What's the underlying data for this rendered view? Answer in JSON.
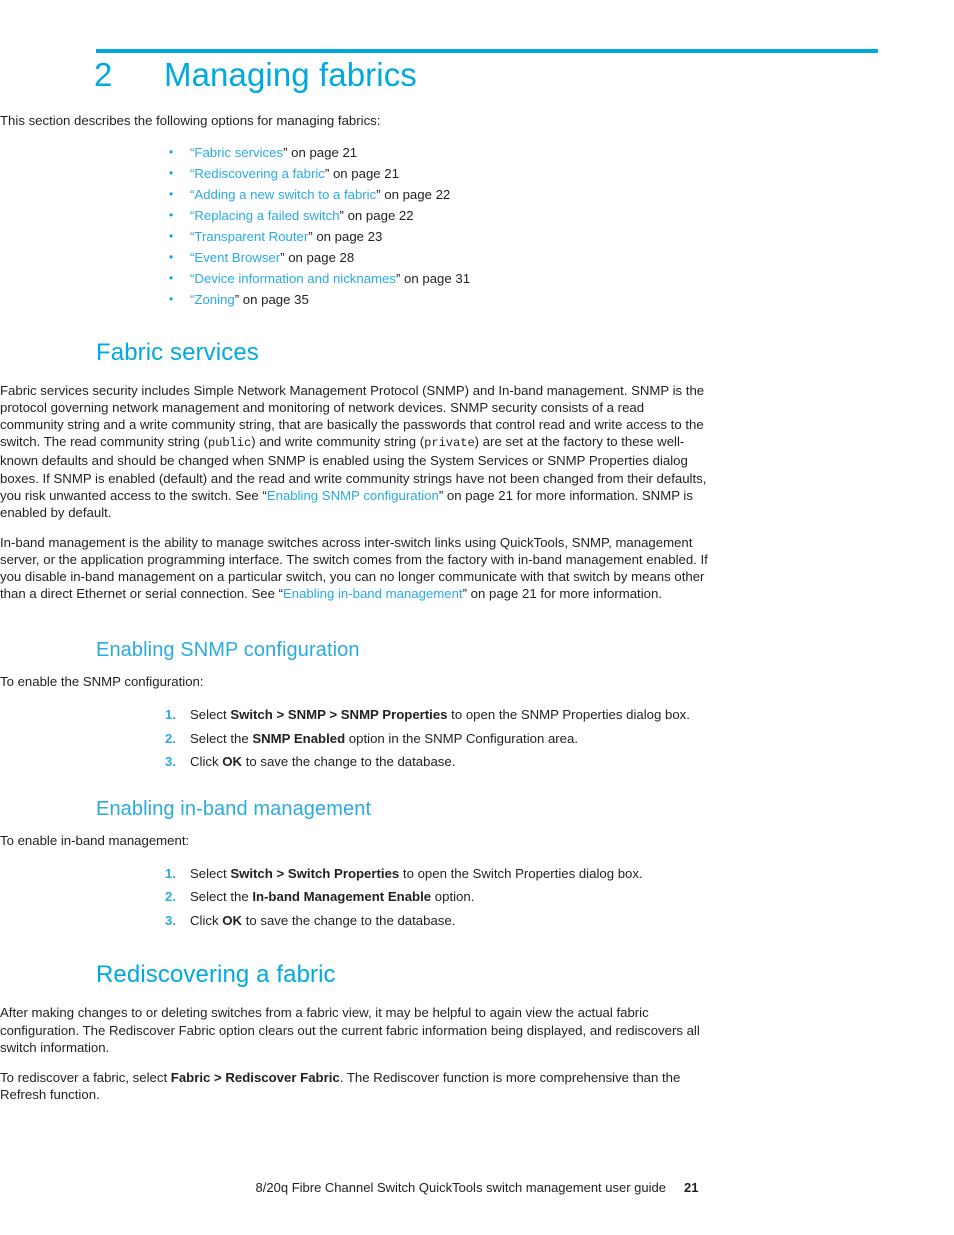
{
  "colors": {
    "accent": "#00a9e0",
    "link": "#29abe2",
    "text": "#231f20"
  },
  "chapter": {
    "number": "2",
    "title": "Managing fabrics"
  },
  "intro": {
    "lead": "This section describes the following options for managing fabrics:",
    "bullets": [
      {
        "link": "Fabric services",
        "tail": "” on page 21"
      },
      {
        "link": "Rediscovering a fabric",
        "tail": "” on page 21"
      },
      {
        "link": "Adding a new switch to a fabric",
        "tail": "” on page 22"
      },
      {
        "link": "Replacing a failed switch",
        "tail": "” on page 22"
      },
      {
        "link": "Transparent Router",
        "tail": "” on page 23"
      },
      {
        "link": "Event Browser",
        "tail": "” on page 28"
      },
      {
        "link": "Device information and nicknames",
        "tail": "” on page 31"
      },
      {
        "link": "Zoning",
        "tail": "” on page 35"
      }
    ],
    "open_quote": "“"
  },
  "fabric_services": {
    "heading": "Fabric services",
    "para1_a": "Fabric services security includes Simple Network Management Protocol (SNMP) and In-band management. SNMP is the protocol governing network management and monitoring of network devices. SNMP security consists of a read community string and a write community string, that are basically the passwords that control read and write access to the switch. The read community string (",
    "mono_public": "public",
    "para1_b": ") and write community string (",
    "mono_private": "private",
    "para1_c": ") are set at the factory to these well-known defaults and should be changed when SNMP is enabled using the System Services or SNMP Properties dialog boxes. If SNMP is enabled (default) and the read and write community strings have not been changed from their defaults, you risk unwanted access to the switch. See “",
    "para1_link": "Enabling SNMP configuration",
    "para1_d": "” on page 21 for more information. SNMP is enabled by default.",
    "para2_a": "In-band management is the ability to manage switches across inter-switch links using QuickTools, SNMP, management server, or the application programming interface. The switch comes from the factory with in-band management enabled. If you disable in-band management on a particular switch, you can no longer communicate with that switch by means other than a direct Ethernet or serial connection. See “",
    "para2_link": "Enabling in-band management",
    "para2_b": "” on page 21 for more information."
  },
  "enabling_snmp": {
    "heading": "Enabling SNMP configuration",
    "lead": "To enable the SNMP configuration:",
    "steps": [
      {
        "num": "1.",
        "pre": "Select ",
        "bold": "Switch > SNMP > SNMP Properties",
        "post": " to open the SNMP Properties dialog box."
      },
      {
        "num": "2.",
        "pre": "Select the ",
        "bold": "SNMP Enabled",
        "post": " option in the SNMP Configuration area."
      },
      {
        "num": "3.",
        "pre": "Click ",
        "bold": "OK",
        "post": " to save the change to the database."
      }
    ]
  },
  "enabling_inband": {
    "heading": "Enabling in-band management",
    "lead": "To enable in-band management:",
    "steps": [
      {
        "num": "1.",
        "pre": "Select ",
        "bold": "Switch > Switch Properties",
        "post": " to open the Switch Properties dialog box."
      },
      {
        "num": "2.",
        "pre": "Select the ",
        "bold": "In-band Management Enable",
        "post": " option."
      },
      {
        "num": "3.",
        "pre": "Click ",
        "bold": "OK",
        "post": " to save the change to the database."
      }
    ]
  },
  "rediscovering": {
    "heading": "Rediscovering a fabric",
    "para1": "After making changes to or deleting switches from a fabric view, it may be helpful to again view the actual fabric configuration. The Rediscover Fabric option clears out the current fabric information being displayed, and rediscovers all switch information.",
    "para2_a": "To rediscover a fabric, select ",
    "para2_bold": "Fabric > Rediscover Fabric",
    "para2_b": ". The Rediscover function is more comprehensive than the Refresh function."
  },
  "footer": {
    "title": "8/20q Fibre Channel Switch QuickTools switch management user guide",
    "page": "21"
  }
}
